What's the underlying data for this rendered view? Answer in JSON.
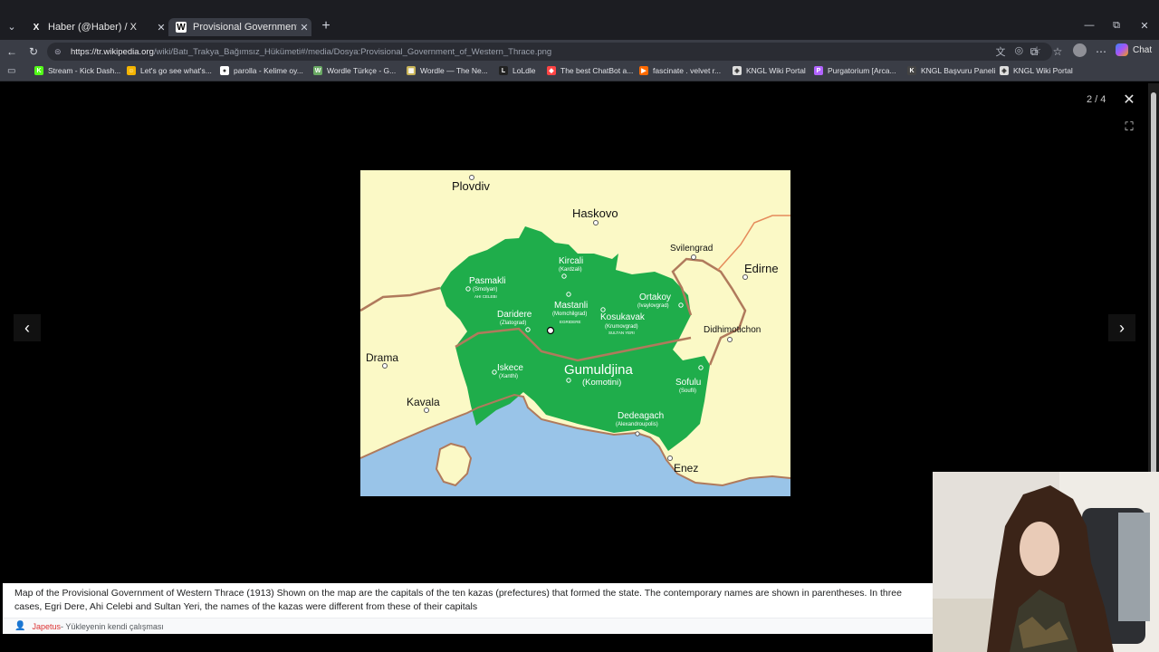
{
  "browser": {
    "tabs": [
      {
        "title": "Haber (@Haber) / X",
        "favicon": "X",
        "active": false
      },
      {
        "title": "Provisional Government of Western Thrace",
        "favicon": "W",
        "active": true
      }
    ],
    "url_domain": "https://tr.wikipedia.org",
    "url_path": "/wiki/Batı_Trakya_Bağımsız_Hükümeti#/media/Dosya:Provisional_Government_of_Western_Thrace.png",
    "copilot_label": "Chat"
  },
  "bookmarks": [
    {
      "label": "Stream - Kick Dash...",
      "icon_color": "#53fc18",
      "icon_text": "K"
    },
    {
      "label": "Let's go see what's...",
      "icon_color": "#f4b400",
      "icon_text": "☺"
    },
    {
      "label": "parolla - Kelime oy...",
      "icon_color": "#ffffff",
      "icon_text": "●"
    },
    {
      "label": "Wordle Türkçe - G...",
      "icon_color": "#6aaa64",
      "icon_text": "W"
    },
    {
      "label": "Wordle — The Ne...",
      "icon_color": "#c9b458",
      "icon_text": "▦"
    },
    {
      "label": "LoLdle",
      "icon_color": "#222222",
      "icon_text": "L"
    },
    {
      "label": "The best ChatBot a...",
      "icon_color": "#ff4444",
      "icon_text": "◆"
    },
    {
      "label": "fascinate . velvet r...",
      "icon_color": "#ff6a00",
      "icon_text": "▶"
    },
    {
      "label": "KNGL Wiki Portal",
      "icon_color": "#dddddd",
      "icon_text": "◈"
    },
    {
      "label": "Purgatorium [Arca...",
      "icon_color": "#b264ff",
      "icon_text": "P"
    },
    {
      "label": "KNGL Başvuru Paneli",
      "icon_color": "#444444",
      "icon_text": "K"
    },
    {
      "label": "KNGL Wiki Portal",
      "icon_color": "#dddddd",
      "icon_text": "◈"
    }
  ],
  "viewer": {
    "counter": "2 / 4",
    "caption": "Map of the Provisional Government of Western Thrace (1913) Shown on the map are the capitals of the ten kazas (prefectures) that formed the state. The contemporary names are shown in parentheses. In three cases, Egri Dere, Ahi Celebi and Sultan Yeri, the names of the kazas were different from these of their capitals",
    "author": "Japetus",
    "credit_rest": " - Yükleyenin kendi çalışması"
  },
  "map": {
    "colors": {
      "sea": "#99c4e8",
      "land": "#fbf9c6",
      "state": "#1fad4b",
      "border": "#b07a5c"
    },
    "outside_cities": {
      "plovdiv": "Plovdiv",
      "haskovo": "Haskovo",
      "svilengrad": "Svilengrad",
      "edirne": "Edirne",
      "didhimotichon": "Didhimotichon",
      "drama": "Drama",
      "kavala": "Kavala",
      "enez": "Enez"
    },
    "kazas": {
      "kircali": {
        "name": "Kircali",
        "alt": "(Kardzali)"
      },
      "pasmakli": {
        "name": "Pasmakli",
        "alt": "(Smolyan)",
        "kaza": "AHI CELEBI"
      },
      "mastanli": {
        "name": "Mastanli",
        "alt": "(Momchilgrad)",
        "kaza": "EGRIDERE"
      },
      "daridere": {
        "name": "Daridere",
        "alt": "(Zlatograd)"
      },
      "ortakoy": {
        "name": "Ortakoy",
        "alt": "(Ivaylovgrad)"
      },
      "kosukavak": {
        "name": "Kosukavak",
        "alt": "(Krumovgrad)",
        "kaza": "SULTAN YERI"
      },
      "iskece": {
        "name": "Iskece",
        "alt": "(Xanthi)"
      },
      "gumuldjina": {
        "name": "Gumuldjina",
        "alt": "(Komotini)"
      },
      "sofulu": {
        "name": "Sofulu",
        "alt": "(Soufli)"
      },
      "dedeagach": {
        "name": "Dedeagach",
        "alt": "(Alexandroupolis)"
      }
    }
  }
}
